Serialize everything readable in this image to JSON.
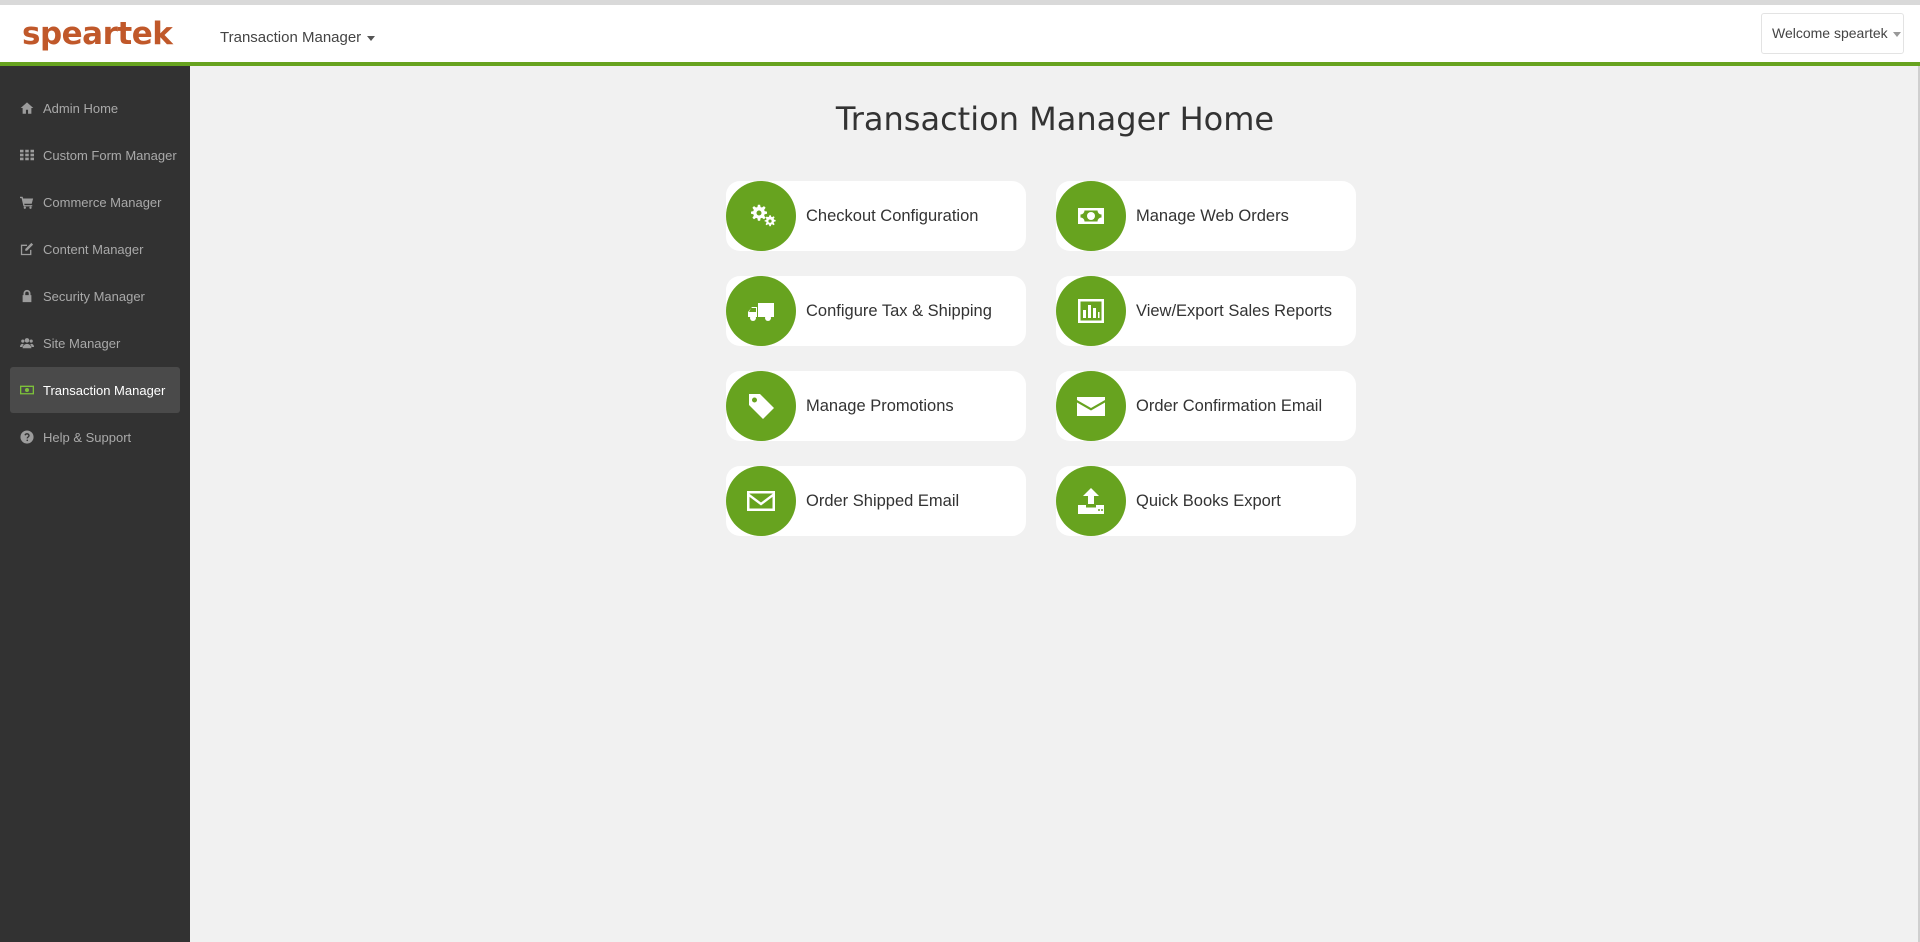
{
  "header": {
    "logo": "speartek",
    "app_menu_label": "Transaction Manager",
    "user_menu_label": "Welcome speartek"
  },
  "sidebar": {
    "items": [
      {
        "label": "Admin Home",
        "icon": "home-icon",
        "active": false
      },
      {
        "label": "Custom Form Manager",
        "icon": "grid-icon",
        "active": false
      },
      {
        "label": "Commerce Manager",
        "icon": "cart-icon",
        "active": false
      },
      {
        "label": "Content Manager",
        "icon": "edit-icon",
        "active": false
      },
      {
        "label": "Security Manager",
        "icon": "lock-icon",
        "active": false
      },
      {
        "label": "Site Manager",
        "icon": "users-icon",
        "active": false
      },
      {
        "label": "Transaction Manager",
        "icon": "money-icon",
        "active": true
      },
      {
        "label": "Help & Support",
        "icon": "question-icon",
        "active": false
      }
    ]
  },
  "main": {
    "title": "Transaction Manager Home",
    "tiles": [
      {
        "label": "Checkout Configuration",
        "icon": "gears-icon"
      },
      {
        "label": "Manage Web Orders",
        "icon": "money-icon"
      },
      {
        "label": "Configure Tax & Shipping",
        "icon": "truck-icon"
      },
      {
        "label": "View/Export Sales Reports",
        "icon": "bar-chart-icon"
      },
      {
        "label": "Manage Promotions",
        "icon": "tag-icon"
      },
      {
        "label": "Order Confirmation Email",
        "icon": "envelope-icon"
      },
      {
        "label": "Order Shipped Email",
        "icon": "envelope-outline-icon"
      },
      {
        "label": "Quick Books Export",
        "icon": "upload-icon"
      }
    ]
  },
  "colors": {
    "accent": "#67a31f",
    "logo": "#c0582a",
    "sidebar_bg": "#323232"
  }
}
